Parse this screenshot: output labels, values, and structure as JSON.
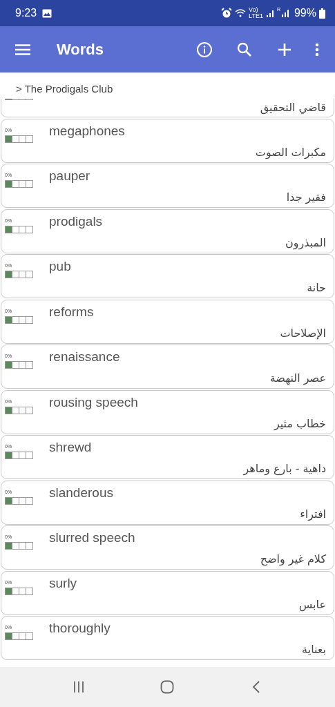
{
  "status_bar": {
    "time": "9:23",
    "volte": [
      "Vo)",
      "LTE1"
    ],
    "roaming": "R",
    "battery": "99%"
  },
  "app_bar": {
    "title": "Words"
  },
  "breadcrumb": "> The Prodigals Club",
  "partial_card": {
    "translation": "قاضي التحقيق",
    "level": 0.25
  },
  "words": [
    {
      "word": "megaphones",
      "translation": "مكبرات الصوت",
      "percent": "0%",
      "level": 0.25
    },
    {
      "word": "pauper",
      "translation": "فقير جدا",
      "percent": "0%",
      "level": 0.25
    },
    {
      "word": "prodigals",
      "translation": "المبذرون",
      "percent": "0%",
      "level": 0.25
    },
    {
      "word": "pub",
      "translation": "حانة",
      "percent": "0%",
      "level": 0.25
    },
    {
      "word": "reforms",
      "translation": "الإصلاحات",
      "percent": "0%",
      "level": 0.25
    },
    {
      "word": "renaissance",
      "translation": "عصر النهضة",
      "percent": "0%",
      "level": 0.25
    },
    {
      "word": "rousing speech",
      "translation": "خطاب مثير",
      "percent": "0%",
      "level": 0.25
    },
    {
      "word": "shrewd",
      "translation": "داهية - بارع وماهر",
      "percent": "0%",
      "level": 0.25
    },
    {
      "word": "slanderous",
      "translation": "افتراء",
      "percent": "0%",
      "level": 0.25
    },
    {
      "word": "slurred speech",
      "translation": "كلام غير واضح",
      "percent": "0%",
      "level": 0.25
    },
    {
      "word": "surly",
      "translation": "عابس",
      "percent": "0%",
      "level": 0.25
    },
    {
      "word": "thoroughly",
      "translation": "بعناية",
      "percent": "0%",
      "level": 0.25
    }
  ]
}
